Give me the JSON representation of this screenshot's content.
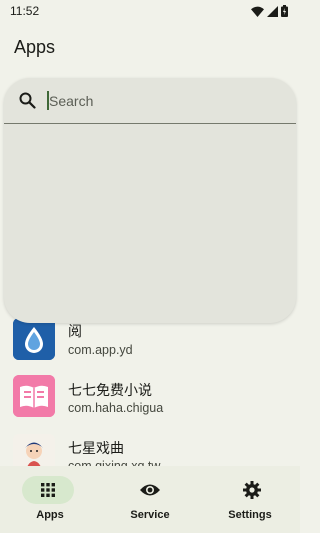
{
  "status_bar": {
    "time": "11:52",
    "icons": [
      "wifi-icon",
      "signal-icon",
      "battery-icon"
    ]
  },
  "app_bar": {
    "title": "Apps"
  },
  "search": {
    "placeholder": "Search",
    "value": ""
  },
  "apps": [
    {
      "name": "阅",
      "package": "com.app.yd",
      "icon": "water-drop-icon",
      "icon_color": "#1f5fa8"
    },
    {
      "name": "七七免费小说",
      "package": "com.haha.chigua",
      "icon": "book-icon",
      "icon_color": "#f27aa8"
    },
    {
      "name": "七星戏曲",
      "package": "com.qixing.xq.tw",
      "icon": "opera-figure-icon",
      "icon_color": "#d9534f"
    }
  ],
  "bottom_nav": [
    {
      "label": "Apps",
      "icon": "grid-icon",
      "active": true
    },
    {
      "label": "Service",
      "icon": "eye-icon",
      "active": false
    },
    {
      "label": "Settings",
      "icon": "gear-icon",
      "active": false
    }
  ],
  "colors": {
    "background": "#f1f2ea",
    "search_surface": "#e3e4dc",
    "nav_active_pill": "#d7e8cd",
    "accent": "#3f6837"
  }
}
